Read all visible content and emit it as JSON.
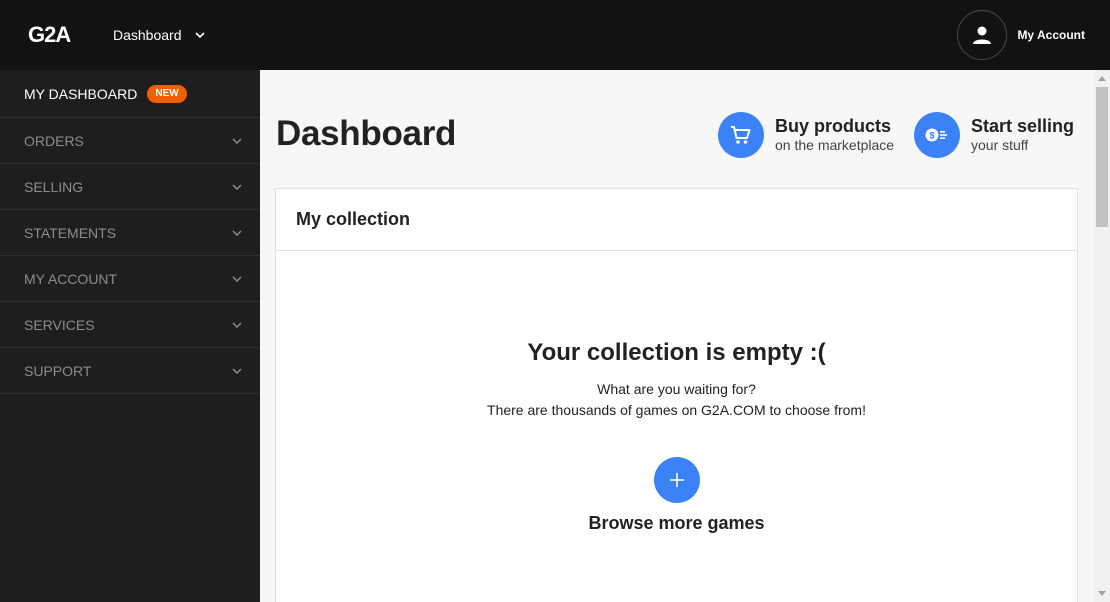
{
  "header": {
    "logo_alt": "G2A",
    "nav_label": "Dashboard",
    "account_label": "My Account"
  },
  "sidebar": {
    "items": [
      {
        "label": "MY DASHBOARD",
        "badge": "NEW",
        "active": true
      },
      {
        "label": "ORDERS"
      },
      {
        "label": "SELLING"
      },
      {
        "label": "STATEMENTS"
      },
      {
        "label": "MY ACCOUNT"
      },
      {
        "label": "SERVICES"
      },
      {
        "label": "SUPPORT"
      }
    ]
  },
  "main": {
    "title": "Dashboard",
    "cta_buy": {
      "title": "Buy products",
      "subtitle": "on the marketplace",
      "icon": "cart-icon"
    },
    "cta_sell": {
      "title": "Start selling",
      "subtitle": "your stuff",
      "icon": "coin-icon"
    },
    "collection": {
      "heading": "My collection",
      "empty_title": "Your collection is empty :(",
      "empty_line1": "What are you waiting for?",
      "empty_line2": "There are thousands of games on G2A.COM to choose from!",
      "browse_label": "Browse more games"
    }
  },
  "colors": {
    "topbar": "#121212",
    "sidebar": "#1e1e1e",
    "accent_blue": "#3b82f6",
    "badge_orange": "#f05f00"
  }
}
